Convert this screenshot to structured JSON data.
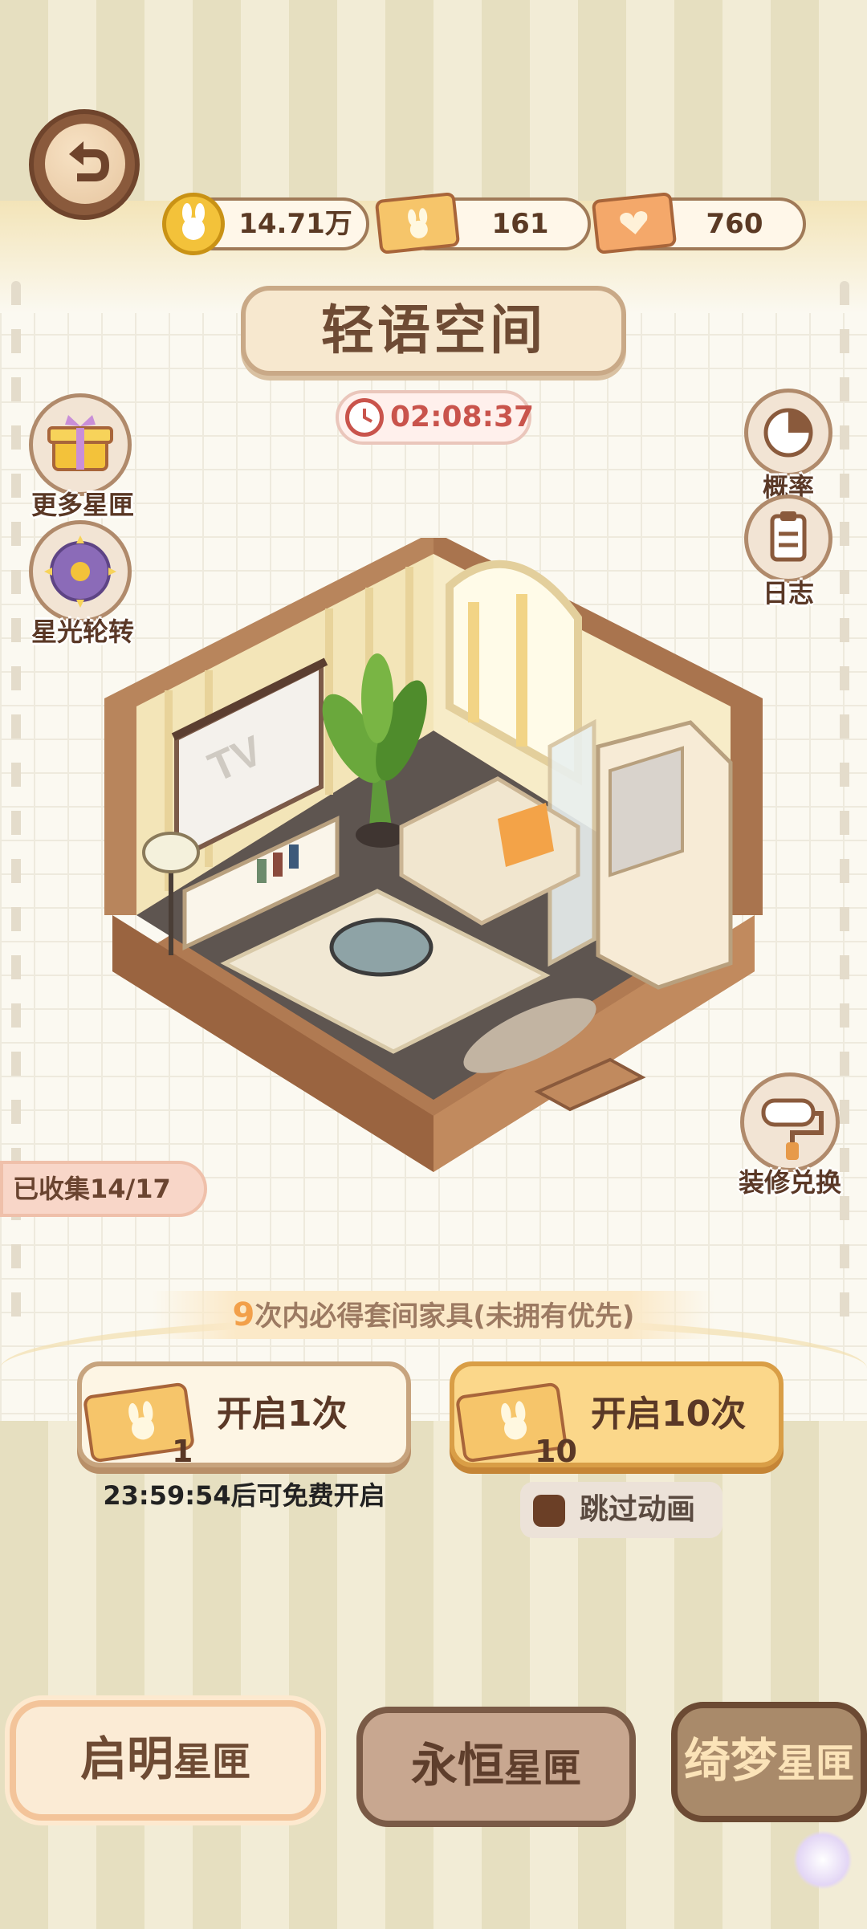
{
  "resources": {
    "coins": "14.71万",
    "tickets": "161",
    "hearts": "760"
  },
  "room": {
    "title": "轻语空间",
    "timer": "02:08:37",
    "tv_text": "TV"
  },
  "side_left": [
    {
      "label": "更多星匣",
      "icon": "gift-box-icon"
    },
    {
      "label": "星光轮转",
      "icon": "star-wheel-icon"
    }
  ],
  "side_right": [
    {
      "label": "概率",
      "icon": "pie-chart-icon"
    },
    {
      "label": "日志",
      "icon": "clipboard-icon"
    },
    {
      "label": "装修兑换",
      "icon": "paint-roller-icon"
    }
  ],
  "collected": "已收集14/17",
  "guarantee": {
    "count": "9",
    "text": "次内必得套间家具(未拥有优先)"
  },
  "draw": {
    "once_label": "开启1次",
    "once_cost": "1",
    "ten_label": "开启10次",
    "ten_cost": "10",
    "free_text": "23:59:54后可免费开启",
    "skip_label": "跳过动画"
  },
  "tabs": [
    {
      "main": "启明",
      "sub": "星匣"
    },
    {
      "main": "永恒",
      "sub": "星匣"
    },
    {
      "main": "绮梦",
      "sub": "星匣"
    }
  ],
  "colors": {
    "accent_orange": "#f2a04a",
    "timer_red": "#c9544c",
    "brown_text": "#5a3826"
  }
}
